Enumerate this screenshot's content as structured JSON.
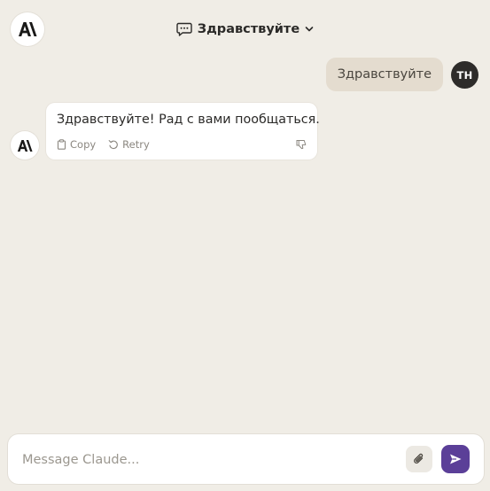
{
  "header": {
    "title": "Здравствуйте"
  },
  "user": {
    "initials": "TH",
    "message": "Здравствуйте"
  },
  "assistant": {
    "message": "Здравствуйте! Рад с вами пообщаться.",
    "actions": {
      "copy": "Copy",
      "retry": "Retry"
    }
  },
  "composer": {
    "placeholder": "Message Claude..."
  },
  "icons": {
    "logo": "anthropic-logo-icon",
    "chat": "chat-bubble-icon",
    "chevron": "chevron-down-icon",
    "copy": "clipboard-icon",
    "retry": "retry-icon",
    "feedback": "thumbs-down-icon",
    "attach": "paperclip-icon",
    "send": "send-icon"
  },
  "colors": {
    "background": "#f0ede6",
    "user_bubble": "#e4dccf",
    "send_button": "#5b3f98",
    "avatar": "#2e2c2a"
  }
}
